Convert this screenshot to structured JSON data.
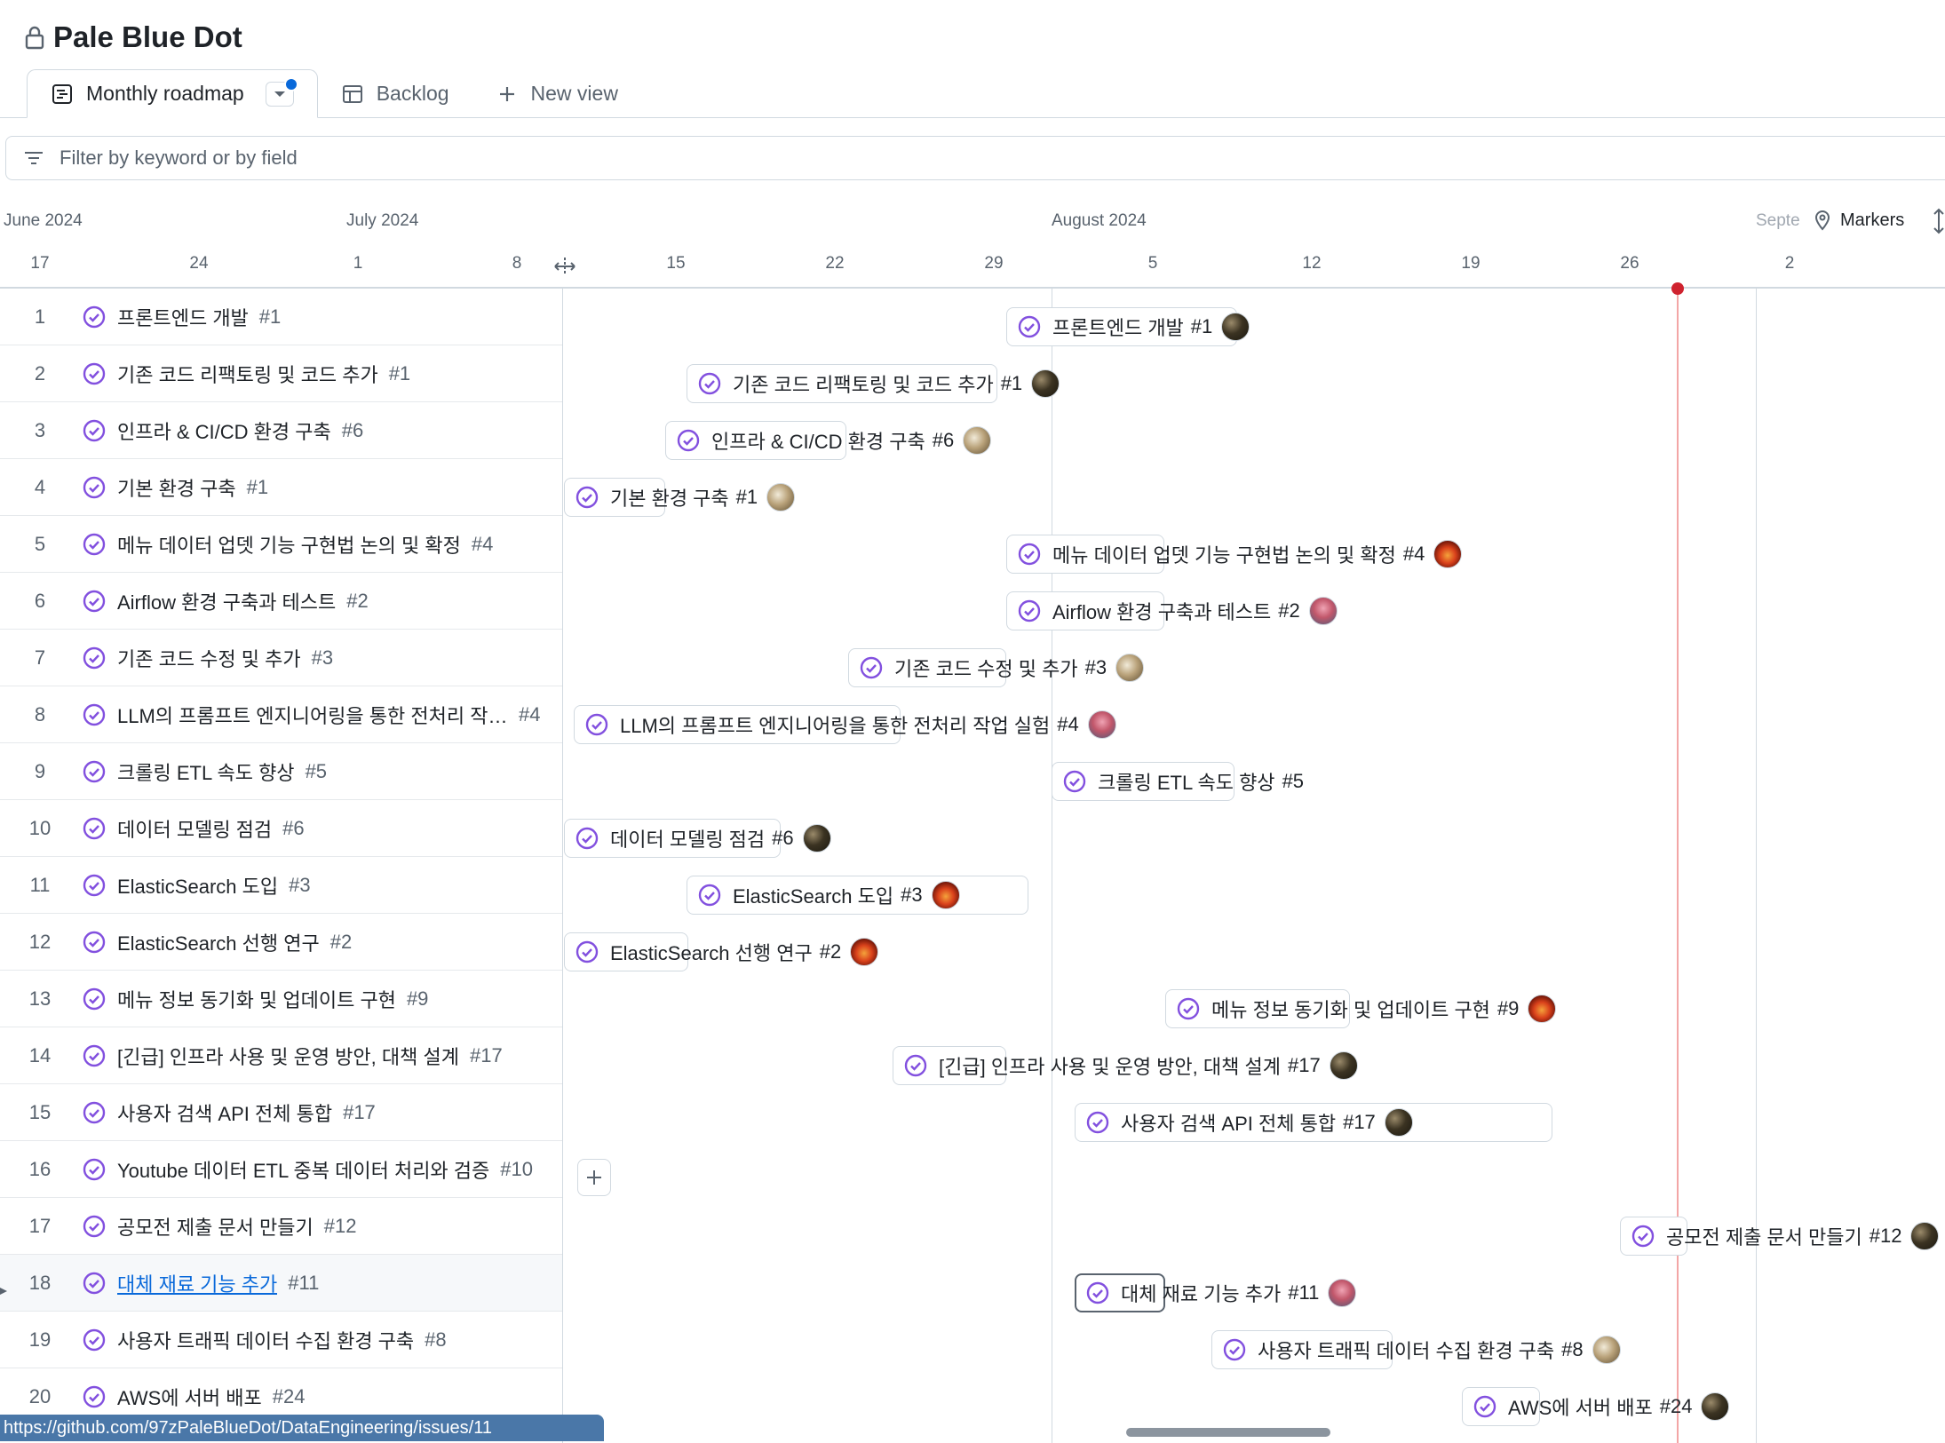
{
  "project": {
    "title": "Pale Blue Dot"
  },
  "tabs": {
    "items": [
      {
        "label": "Monthly roadmap",
        "icon": "roadmap-icon"
      },
      {
        "label": "Backlog",
        "icon": "table-icon"
      },
      {
        "label": "New view",
        "icon": "plus-icon"
      }
    ]
  },
  "filter": {
    "placeholder": "Filter by keyword or by field"
  },
  "timeline": {
    "months": [
      "June 2024",
      "July 2024",
      "August 2024",
      "Septe"
    ],
    "days": [
      "17",
      "24",
      "1",
      "8",
      "15",
      "22",
      "29",
      "5",
      "12",
      "19",
      "26",
      "2"
    ],
    "markers_label": "Markers"
  },
  "rows": [
    {
      "n": "1",
      "title": "프론트엔드 개발",
      "issue": "#1",
      "bar_title": "프론트엔드 개발",
      "avatar": "dark"
    },
    {
      "n": "2",
      "title": "기존 코드 리팩토링 및 코드 추가",
      "issue": "#1",
      "bar_title": "기존 코드 리팩토링 및 코드 추가",
      "avatar": "dark"
    },
    {
      "n": "3",
      "title": "인프라 & CI/CD 환경 구축",
      "issue": "#6",
      "bar_title": "인프라 & CI/CD 환경 구축",
      "avatar": "light"
    },
    {
      "n": "4",
      "title": "기본 환경 구축",
      "issue": "#1",
      "bar_title": "기본 환경 구축",
      "avatar": "light"
    },
    {
      "n": "5",
      "title": "메뉴 데이터 업뎃 기능 구현법 논의 및 확정",
      "issue": "#4",
      "bar_title": "메뉴 데이터 업뎃 기능 구현법 논의 및 확정",
      "avatar": "sun"
    },
    {
      "n": "6",
      "title": "Airflow 환경 구축과 테스트",
      "issue": "#2",
      "bar_title": "Airflow 환경 구축과 테스트",
      "avatar": "pink"
    },
    {
      "n": "7",
      "title": "기존 코드 수정 및 추가",
      "issue": "#3",
      "bar_title": "기존 코드 수정 및 추가",
      "avatar": "light"
    },
    {
      "n": "8",
      "title": "LLM의 프롬프트 엔지니어링을 통한 전처리 작업...",
      "issue": "#4",
      "bar_title": "LLM의 프롬프트 엔지니어링을 통한 전처리 작업 실험",
      "avatar": "pink"
    },
    {
      "n": "9",
      "title": "크롤링 ETL 속도 향상",
      "issue": "#5",
      "bar_title": "크롤링 ETL 속도 향상",
      "avatar": ""
    },
    {
      "n": "10",
      "title": "데이터 모델링 점검",
      "issue": "#6",
      "bar_title": "데이터 모델링 점검",
      "avatar": "dark"
    },
    {
      "n": "11",
      "title": "ElasticSearch 도입",
      "issue": "#3",
      "bar_title": "ElasticSearch 도입",
      "avatar": "sun"
    },
    {
      "n": "12",
      "title": "ElasticSearch 선행 연구",
      "issue": "#2",
      "bar_title": "ElasticSearch 선행 연구",
      "avatar": "sun"
    },
    {
      "n": "13",
      "title": "메뉴 정보 동기화 및 업데이트 구현",
      "issue": "#9",
      "bar_title": "메뉴 정보 동기화 및 업데이트 구현",
      "avatar": "sun"
    },
    {
      "n": "14",
      "title": "[긴급] 인프라 사용 및 운영 방안, 대책 설계",
      "issue": "#17",
      "bar_title": "[긴급] 인프라 사용 및 운영 방안, 대책 설계",
      "avatar": "dark"
    },
    {
      "n": "15",
      "title": "사용자 검색 API 전체 통합",
      "issue": "#17",
      "bar_title": "사용자 검색 API 전체 통합",
      "avatar": "dark"
    },
    {
      "n": "16",
      "title": "Youtube 데이터 ETL 중복 데이터 처리와 검증",
      "issue": "#10",
      "bar_title": "",
      "avatar": ""
    },
    {
      "n": "17",
      "title": "공모전 제출 문서 만들기",
      "issue": "#12",
      "bar_title": "공모전 제출 문서 만들기",
      "avatar": "dark"
    },
    {
      "n": "18",
      "title": "대체 재료 기능 추가",
      "issue": "#11",
      "bar_title": "대체 재료 기능 추가",
      "avatar": "pink"
    },
    {
      "n": "19",
      "title": "사용자 트래픽 데이터 수집 환경 구축",
      "issue": "#8",
      "bar_title": "사용자 트래픽 데이터 수집 환경 구축",
      "avatar": "light"
    },
    {
      "n": "20",
      "title": "AWS에 서버 배포",
      "issue": "#24",
      "bar_title": "AWS에 서버 배포",
      "avatar": "dark"
    }
  ],
  "status_bar": {
    "url": "https://github.com/97zPaleBlueDot/DataEngineering/issues/11"
  },
  "colors": {
    "accent": "#0969da",
    "done_purple": "#8250df",
    "today_red": "#cf222e",
    "border": "#d1d9e0"
  }
}
